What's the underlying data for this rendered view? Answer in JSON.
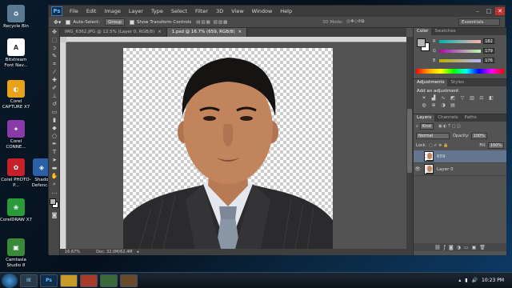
{
  "desktop": {
    "icons": [
      {
        "label": "Recycle Bin",
        "icon": "recycle-bin-icon",
        "color": "#5a7a94"
      },
      {
        "label": "Bitstream Font Nav...",
        "icon": "font-navigator-icon",
        "color": "#ffffff"
      },
      {
        "label": "Corel CAPTURE X7",
        "icon": "corel-capture-icon",
        "color": "#e8a21a"
      },
      {
        "label": "Corel CONNE...",
        "icon": "corel-connect-icon",
        "color": "#8a3aa8"
      },
      {
        "label": "Corel PHOTO-P...",
        "icon": "corel-photo-paint-icon",
        "color": "#c8202a"
      },
      {
        "label": "Shado Defenc...",
        "icon": "shadow-defender-icon",
        "color": "#2b5fa8"
      },
      {
        "label": "CorelDRAW X7",
        "icon": "coreldraw-icon",
        "color": "#2a9a3a"
      },
      {
        "label": "Camtasia Studio 8",
        "icon": "camtasia-icon",
        "color": "#3a8a3a"
      }
    ]
  },
  "photoshop": {
    "logo": "Ps",
    "menu": [
      "File",
      "Edit",
      "Image",
      "Layer",
      "Type",
      "Select",
      "Filter",
      "3D",
      "View",
      "Window",
      "Help"
    ],
    "options": {
      "auto_select_label": "Auto-Select:",
      "auto_select_value": "Group",
      "show_transform_label": "Show Transform Controls",
      "mode_3d_label": "3D Mode:",
      "workspace": "Essentials"
    },
    "tabs": [
      {
        "label": "IMG_6362.JPG @ 12.5% (Layer 0, RGB/8)",
        "active": false
      },
      {
        "label": "1.psd @ 16.7% (659, RGB/8)",
        "active": true
      }
    ],
    "status": {
      "zoom": "16.67%",
      "doc": "Doc: 32.0M/62.4M"
    },
    "color_panel": {
      "tabs": [
        "Color",
        "Swatches"
      ],
      "channels": [
        {
          "name": "R",
          "value": "182"
        },
        {
          "name": "G",
          "value": "179"
        },
        {
          "name": "B",
          "value": "176"
        }
      ],
      "foreground": "#b6b3b0",
      "background": "#ffffff"
    },
    "adjustments_panel": {
      "tabs": [
        "Adjustments",
        "Styles"
      ],
      "title": "Add an adjustment"
    },
    "layers_panel": {
      "tabs": [
        "Layers",
        "Channels",
        "Paths"
      ],
      "kind": "Kind",
      "blend_mode": "Normal",
      "opacity_label": "Opacity:",
      "opacity": "100%",
      "lock_label": "Lock:",
      "fill_label": "Fill:",
      "fill": "100%",
      "layers": [
        {
          "name": "659",
          "active": true
        },
        {
          "name": "Layer 0",
          "active": false
        }
      ]
    }
  },
  "taskbar": {
    "apps": [
      "IE",
      "Ps",
      "",
      "",
      "",
      ""
    ],
    "time": "10:23 PM"
  }
}
